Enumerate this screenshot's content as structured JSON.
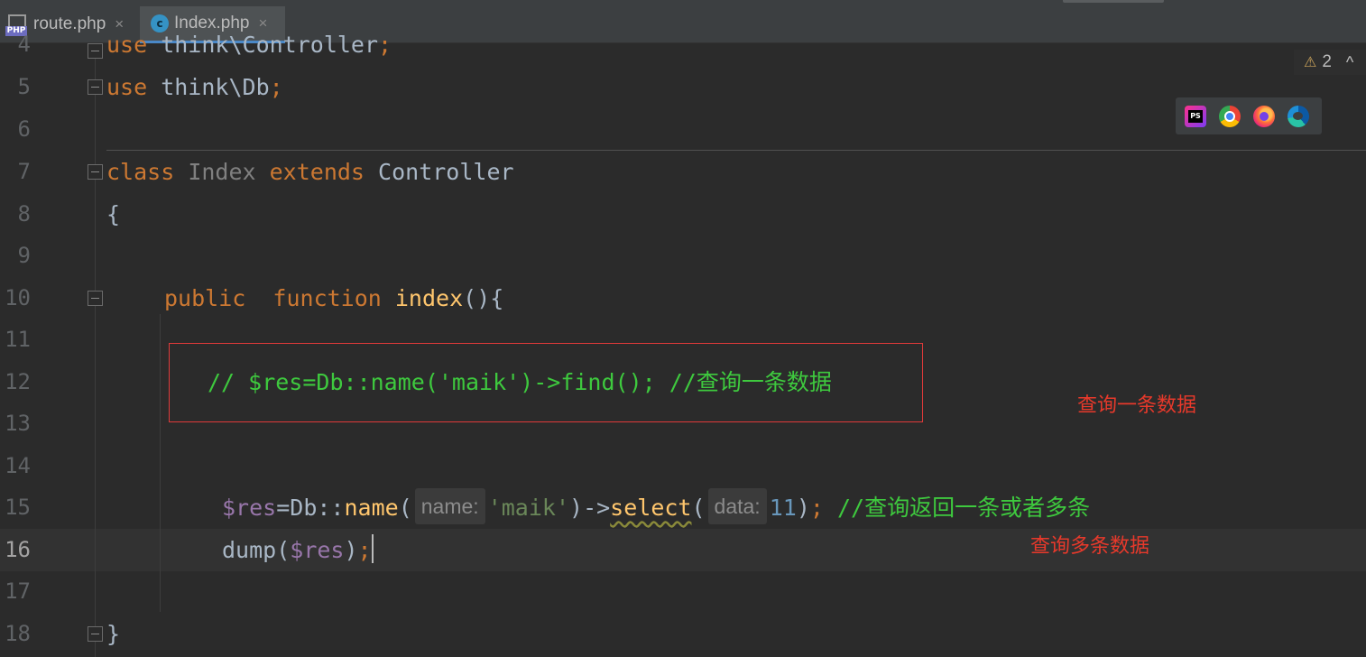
{
  "tabs": [
    {
      "label": "route.php",
      "icon": "php-file-icon",
      "active": false
    },
    {
      "label": "Index.php",
      "icon": "php-class-icon",
      "active": true
    }
  ],
  "tab_close_glyph": "×",
  "php_icon_text": "PHP",
  "class_icon_text": "c",
  "inspections": {
    "warning_count": "2"
  },
  "browsers": [
    "phpstorm-icon",
    "chrome-icon",
    "firefox-icon",
    "edge-icon"
  ],
  "lines": {
    "n4": "4",
    "n5": "5",
    "n6": "6",
    "n7": "7",
    "n8": "8",
    "n9": "9",
    "n10": "10",
    "n11": "11",
    "n12": "12",
    "n13": "13",
    "n14": "14",
    "n15": "15",
    "n16": "16",
    "n17": "17",
    "n18": "18"
  },
  "code": {
    "l4_kw": "use",
    "l4_rest": " think\\Controller",
    "l4_semi": ";",
    "l5_kw": "use",
    "l5_rest": " think\\Db",
    "l5_semi": ";",
    "l7_class": "class",
    "l7_name": " Index ",
    "l7_extends": "extends",
    "l7_parent": " Controller",
    "l8_brace": "{",
    "l10_public": "public",
    "l10_function": "  function",
    "l10_name": " index",
    "l10_rest": "(){",
    "l12_comment": "// $res=Db::name('maik')->find(); //查询一条数据",
    "l15_var": "$res",
    "l15_a": "=Db::",
    "l15_name": "name",
    "l15_paren": "(",
    "l15_hint1": "name:",
    "l15_str": "'maik'",
    "l15_b": ")->",
    "l15_select": "select",
    "l15_paren2": "(",
    "l15_hint2": "data:",
    "l15_num": "11",
    "l15_close": ")",
    "l15_semi": ";",
    "l15_comment": " //查询返回一条或者多条",
    "l16_fn": "dump(",
    "l16_var": "$res",
    "l16_close": ")",
    "l16_semi": ";",
    "l18_brace": "}"
  },
  "annotations": {
    "single": "查询一条数据",
    "multi": "查询多条数据"
  },
  "colors": {
    "background": "#2b2b2b",
    "keyword": "#cc7832",
    "function": "#ffc66d",
    "variable": "#9876aa",
    "comment_green": "#3ec93e",
    "annotation_red": "#e8392b"
  }
}
